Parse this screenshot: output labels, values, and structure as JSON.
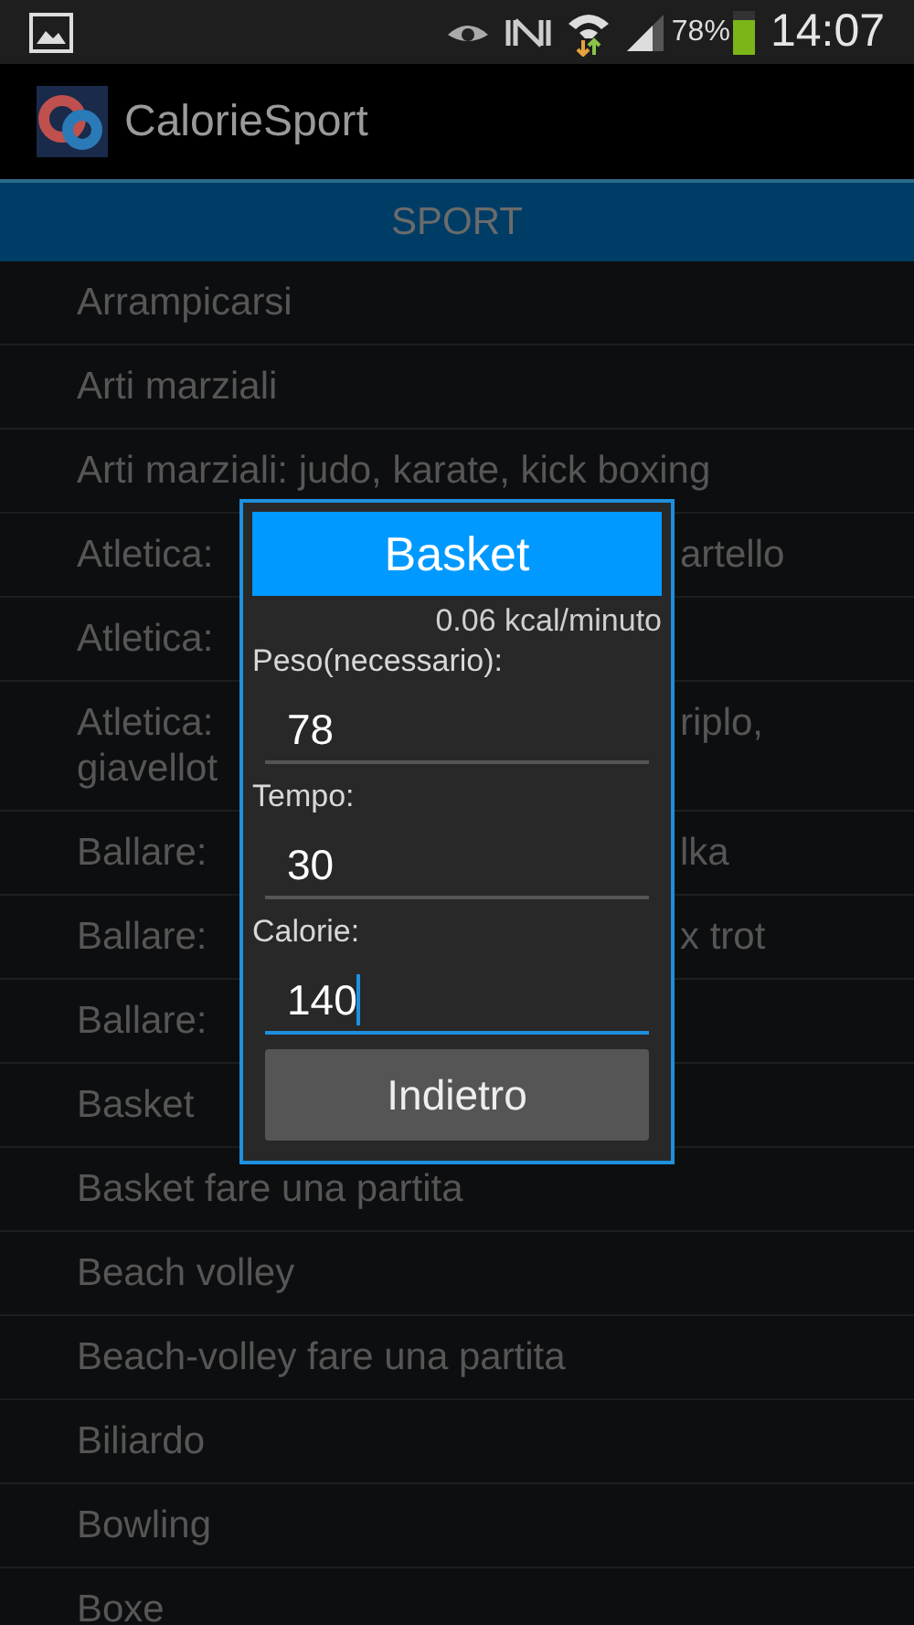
{
  "status_bar": {
    "battery": "78%",
    "time": "14:07"
  },
  "app_bar": {
    "title": "CalorieSport"
  },
  "section_header": "SPORT",
  "list": [
    {
      "lines": [
        {
          "left": "Arrampicarsi"
        }
      ]
    },
    {
      "lines": [
        {
          "left": "Arti marziali"
        }
      ]
    },
    {
      "lines": [
        {
          "left": "Arti marziali: judo, karate, kick boxing"
        }
      ]
    },
    {
      "lines": [
        {
          "left": "Atletica:",
          "right": "artello"
        }
      ]
    },
    {
      "lines": [
        {
          "left": "Atletica:"
        }
      ]
    },
    {
      "lines": [
        {
          "left": "Atletica:",
          "right": "riplo,"
        },
        {
          "left": "giavellot"
        }
      ]
    },
    {
      "lines": [
        {
          "left": "Ballare:",
          "right": "lka"
        }
      ]
    },
    {
      "lines": [
        {
          "left": "Ballare:",
          "right": "x trot"
        }
      ]
    },
    {
      "lines": [
        {
          "left": "Ballare:"
        }
      ]
    },
    {
      "lines": [
        {
          "left": "Basket"
        }
      ]
    },
    {
      "lines": [
        {
          "left": "Basket fare una partita"
        }
      ]
    },
    {
      "lines": [
        {
          "left": "Beach volley"
        }
      ]
    },
    {
      "lines": [
        {
          "left": "Beach-volley fare una partita"
        }
      ]
    },
    {
      "lines": [
        {
          "left": "Biliardo"
        }
      ]
    },
    {
      "lines": [
        {
          "left": "Bowling"
        }
      ]
    },
    {
      "lines": [
        {
          "left": "Boxe"
        }
      ]
    }
  ],
  "dialog": {
    "title": "Basket",
    "rate": "0.06 kcal/minuto",
    "fields": [
      {
        "label": "Peso(necessario):",
        "value": "78",
        "focused": false
      },
      {
        "label": "Tempo:",
        "value": "30",
        "focused": false
      },
      {
        "label": "Calorie:",
        "value": "140",
        "focused": true
      }
    ],
    "button": "Indietro"
  }
}
